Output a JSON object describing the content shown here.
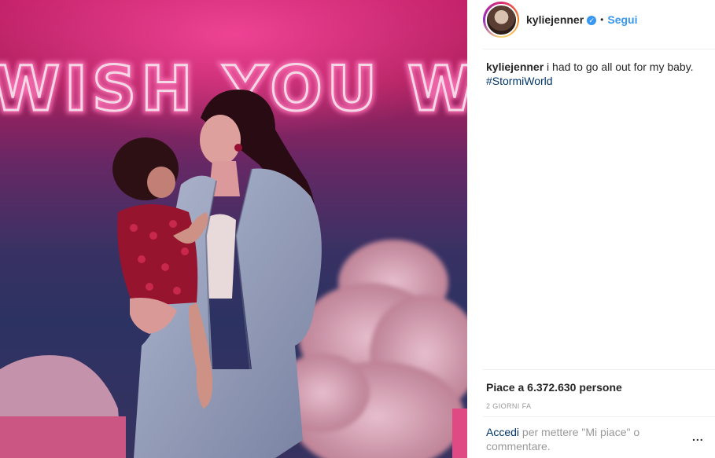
{
  "photo": {
    "neon_text": "WISH YOU WERE"
  },
  "post": {
    "username": "kyliejenner",
    "follow_label": "Segui",
    "separator": "•",
    "verified_glyph": "✓",
    "caption_user": "kyliejenner",
    "caption_text": " i had to go all out for my baby.",
    "hashtag": "#StormiWorld",
    "likes": "Piace a 6.372.630 persone",
    "time": "2 GIORNI FA",
    "login_link": "Accedi",
    "login_text": " per mettere \"Mi piace\" o commentare.",
    "more_label": "..."
  },
  "colors": {
    "link": "#3897f0",
    "hashtag": "#003569",
    "neon": "#ff9ad0",
    "muted": "#999999"
  },
  "icons": {
    "verified": "verified-badge-icon",
    "more": "more-options-icon"
  }
}
